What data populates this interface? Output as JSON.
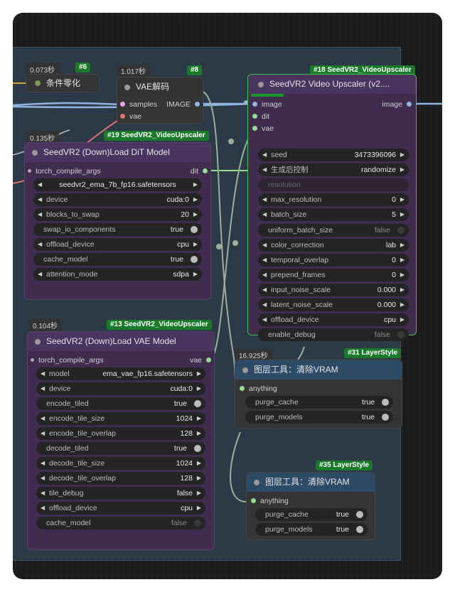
{
  "nodes": {
    "n6": {
      "tag": "#6",
      "time": "0.073秒",
      "title": "条件零化"
    },
    "n8": {
      "tag": "#8",
      "time": "1.017秒",
      "title": "VAE解码",
      "inputs": [
        "samples",
        "vae"
      ],
      "output": "IMAGE"
    },
    "n18": {
      "tag": "#18 SeedVR2_VideoUpscaler",
      "title": "SeedVR2 Video Upscaler (v2....",
      "inputs": [
        "image",
        "dit",
        "vae"
      ],
      "output": "image",
      "widgets": [
        {
          "label": "seed",
          "value": "3473396096",
          "kind": "number"
        },
        {
          "label": "生成后控制",
          "value": "randomize",
          "kind": "combo"
        },
        {
          "label": "resolution",
          "value": "",
          "kind": "dim"
        },
        {
          "label": "max_resolution",
          "value": "0",
          "kind": "number"
        },
        {
          "label": "batch_size",
          "value": "5",
          "kind": "number"
        },
        {
          "label": "uniform_batch_size",
          "value": "false",
          "kind": "toggle",
          "on": false
        },
        {
          "label": "color_correction",
          "value": "lab",
          "kind": "combo"
        },
        {
          "label": "temporal_overlap",
          "value": "0",
          "kind": "number"
        },
        {
          "label": "prepend_frames",
          "value": "0",
          "kind": "number"
        },
        {
          "label": "input_noise_scale",
          "value": "0.000",
          "kind": "number"
        },
        {
          "label": "latent_noise_scale",
          "value": "0.000",
          "kind": "number"
        },
        {
          "label": "offload_device",
          "value": "cpu",
          "kind": "combo"
        },
        {
          "label": "enable_debug",
          "value": "false",
          "kind": "toggle",
          "on": false
        }
      ]
    },
    "n19": {
      "tag": "#19 SeedVR2_VideoUpscaler",
      "time": "0.135秒",
      "title": "SeedVR2 (Down)Load DiT Model",
      "input": "torch_compile_args",
      "output": "dit",
      "widgets": [
        {
          "label": "",
          "value": "seedvr2_ema_7b_fp16.safetensors",
          "kind": "combo-center"
        },
        {
          "label": "device",
          "value": "cuda:0",
          "kind": "combo"
        },
        {
          "label": "blocks_to_swap",
          "value": "20",
          "kind": "number"
        },
        {
          "label": "swap_io_components",
          "value": "true",
          "kind": "toggle",
          "on": true
        },
        {
          "label": "offload_device",
          "value": "cpu",
          "kind": "combo"
        },
        {
          "label": "cache_model",
          "value": "true",
          "kind": "toggle",
          "on": true
        },
        {
          "label": "attention_mode",
          "value": "sdpa",
          "kind": "combo"
        }
      ]
    },
    "n13": {
      "tag": "#13 SeedVR2_VideoUpscaler",
      "time": "0.104秒",
      "title": "SeedVR2 (Down)Load VAE Model",
      "input": "torch_compile_args",
      "output": "vae",
      "widgets": [
        {
          "label": "model",
          "value": "ema_vae_fp16.safetensors",
          "kind": "combo"
        },
        {
          "label": "device",
          "value": "cuda:0",
          "kind": "combo"
        },
        {
          "label": "encode_tiled",
          "value": "true",
          "kind": "toggle",
          "on": true
        },
        {
          "label": "encode_tile_size",
          "value": "1024",
          "kind": "number"
        },
        {
          "label": "encode_tile_overlap",
          "value": "128",
          "kind": "number"
        },
        {
          "label": "decode_tiled",
          "value": "true",
          "kind": "toggle",
          "on": true
        },
        {
          "label": "decode_tile_size",
          "value": "1024",
          "kind": "number"
        },
        {
          "label": "decode_tile_overlap",
          "value": "128",
          "kind": "number"
        },
        {
          "label": "tile_debug",
          "value": "false",
          "kind": "combo"
        },
        {
          "label": "offload_device",
          "value": "cpu",
          "kind": "combo"
        },
        {
          "label": "cache_model",
          "value": "false",
          "kind": "toggle",
          "on": false
        }
      ]
    },
    "n31": {
      "tag": "#31 LayerStyle",
      "time": "16.925秒",
      "title": "图层工具：清除VRAM",
      "input": "anything",
      "widgets": [
        {
          "label": "purge_cache",
          "value": "true",
          "kind": "toggle",
          "on": true
        },
        {
          "label": "purge_models",
          "value": "true",
          "kind": "toggle",
          "on": true
        }
      ]
    },
    "n35": {
      "tag": "#35 LayerStyle",
      "title": "图层工具：清除VRAM",
      "input": "anything",
      "widgets": [
        {
          "label": "purge_cache",
          "value": "true",
          "kind": "toggle",
          "on": true
        },
        {
          "label": "purge_models",
          "value": "true",
          "kind": "toggle",
          "on": true
        }
      ]
    }
  },
  "colors": {
    "image_slot": "#8fb4e0",
    "vae_slot": "#e07070",
    "samples_slot": "#f0a0f0",
    "generic_slot": "#90e090",
    "tag_bg": "#1a7a2a",
    "selected_outline": "#3fbf4f"
  }
}
